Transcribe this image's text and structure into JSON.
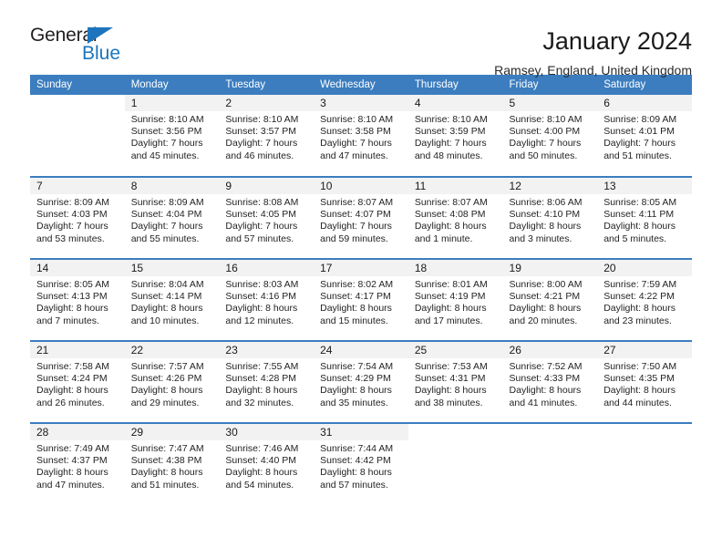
{
  "brand": {
    "name_part1": "General",
    "name_part2": "Blue",
    "accent_color": "#1c75bc",
    "triangle_icon": "brand-triangle-icon"
  },
  "header": {
    "title": "January 2024",
    "location": "Ramsey, England, United Kingdom"
  },
  "calendar": {
    "header_background": "#3b7dbf",
    "daynum_background": "#f2f2f2",
    "weekdays": [
      "Sunday",
      "Monday",
      "Tuesday",
      "Wednesday",
      "Thursday",
      "Friday",
      "Saturday"
    ],
    "weeks": [
      [
        {
          "day": "",
          "sunrise": "",
          "sunset": "",
          "daylight1": "",
          "daylight2": ""
        },
        {
          "day": "1",
          "sunrise": "Sunrise: 8:10 AM",
          "sunset": "Sunset: 3:56 PM",
          "daylight1": "Daylight: 7 hours",
          "daylight2": "and 45 minutes."
        },
        {
          "day": "2",
          "sunrise": "Sunrise: 8:10 AM",
          "sunset": "Sunset: 3:57 PM",
          "daylight1": "Daylight: 7 hours",
          "daylight2": "and 46 minutes."
        },
        {
          "day": "3",
          "sunrise": "Sunrise: 8:10 AM",
          "sunset": "Sunset: 3:58 PM",
          "daylight1": "Daylight: 7 hours",
          "daylight2": "and 47 minutes."
        },
        {
          "day": "4",
          "sunrise": "Sunrise: 8:10 AM",
          "sunset": "Sunset: 3:59 PM",
          "daylight1": "Daylight: 7 hours",
          "daylight2": "and 48 minutes."
        },
        {
          "day": "5",
          "sunrise": "Sunrise: 8:10 AM",
          "sunset": "Sunset: 4:00 PM",
          "daylight1": "Daylight: 7 hours",
          "daylight2": "and 50 minutes."
        },
        {
          "day": "6",
          "sunrise": "Sunrise: 8:09 AM",
          "sunset": "Sunset: 4:01 PM",
          "daylight1": "Daylight: 7 hours",
          "daylight2": "and 51 minutes."
        }
      ],
      [
        {
          "day": "7",
          "sunrise": "Sunrise: 8:09 AM",
          "sunset": "Sunset: 4:03 PM",
          "daylight1": "Daylight: 7 hours",
          "daylight2": "and 53 minutes."
        },
        {
          "day": "8",
          "sunrise": "Sunrise: 8:09 AM",
          "sunset": "Sunset: 4:04 PM",
          "daylight1": "Daylight: 7 hours",
          "daylight2": "and 55 minutes."
        },
        {
          "day": "9",
          "sunrise": "Sunrise: 8:08 AM",
          "sunset": "Sunset: 4:05 PM",
          "daylight1": "Daylight: 7 hours",
          "daylight2": "and 57 minutes."
        },
        {
          "day": "10",
          "sunrise": "Sunrise: 8:07 AM",
          "sunset": "Sunset: 4:07 PM",
          "daylight1": "Daylight: 7 hours",
          "daylight2": "and 59 minutes."
        },
        {
          "day": "11",
          "sunrise": "Sunrise: 8:07 AM",
          "sunset": "Sunset: 4:08 PM",
          "daylight1": "Daylight: 8 hours",
          "daylight2": "and 1 minute."
        },
        {
          "day": "12",
          "sunrise": "Sunrise: 8:06 AM",
          "sunset": "Sunset: 4:10 PM",
          "daylight1": "Daylight: 8 hours",
          "daylight2": "and 3 minutes."
        },
        {
          "day": "13",
          "sunrise": "Sunrise: 8:05 AM",
          "sunset": "Sunset: 4:11 PM",
          "daylight1": "Daylight: 8 hours",
          "daylight2": "and 5 minutes."
        }
      ],
      [
        {
          "day": "14",
          "sunrise": "Sunrise: 8:05 AM",
          "sunset": "Sunset: 4:13 PM",
          "daylight1": "Daylight: 8 hours",
          "daylight2": "and 7 minutes."
        },
        {
          "day": "15",
          "sunrise": "Sunrise: 8:04 AM",
          "sunset": "Sunset: 4:14 PM",
          "daylight1": "Daylight: 8 hours",
          "daylight2": "and 10 minutes."
        },
        {
          "day": "16",
          "sunrise": "Sunrise: 8:03 AM",
          "sunset": "Sunset: 4:16 PM",
          "daylight1": "Daylight: 8 hours",
          "daylight2": "and 12 minutes."
        },
        {
          "day": "17",
          "sunrise": "Sunrise: 8:02 AM",
          "sunset": "Sunset: 4:17 PM",
          "daylight1": "Daylight: 8 hours",
          "daylight2": "and 15 minutes."
        },
        {
          "day": "18",
          "sunrise": "Sunrise: 8:01 AM",
          "sunset": "Sunset: 4:19 PM",
          "daylight1": "Daylight: 8 hours",
          "daylight2": "and 17 minutes."
        },
        {
          "day": "19",
          "sunrise": "Sunrise: 8:00 AM",
          "sunset": "Sunset: 4:21 PM",
          "daylight1": "Daylight: 8 hours",
          "daylight2": "and 20 minutes."
        },
        {
          "day": "20",
          "sunrise": "Sunrise: 7:59 AM",
          "sunset": "Sunset: 4:22 PM",
          "daylight1": "Daylight: 8 hours",
          "daylight2": "and 23 minutes."
        }
      ],
      [
        {
          "day": "21",
          "sunrise": "Sunrise: 7:58 AM",
          "sunset": "Sunset: 4:24 PM",
          "daylight1": "Daylight: 8 hours",
          "daylight2": "and 26 minutes."
        },
        {
          "day": "22",
          "sunrise": "Sunrise: 7:57 AM",
          "sunset": "Sunset: 4:26 PM",
          "daylight1": "Daylight: 8 hours",
          "daylight2": "and 29 minutes."
        },
        {
          "day": "23",
          "sunrise": "Sunrise: 7:55 AM",
          "sunset": "Sunset: 4:28 PM",
          "daylight1": "Daylight: 8 hours",
          "daylight2": "and 32 minutes."
        },
        {
          "day": "24",
          "sunrise": "Sunrise: 7:54 AM",
          "sunset": "Sunset: 4:29 PM",
          "daylight1": "Daylight: 8 hours",
          "daylight2": "and 35 minutes."
        },
        {
          "day": "25",
          "sunrise": "Sunrise: 7:53 AM",
          "sunset": "Sunset: 4:31 PM",
          "daylight1": "Daylight: 8 hours",
          "daylight2": "and 38 minutes."
        },
        {
          "day": "26",
          "sunrise": "Sunrise: 7:52 AM",
          "sunset": "Sunset: 4:33 PM",
          "daylight1": "Daylight: 8 hours",
          "daylight2": "and 41 minutes."
        },
        {
          "day": "27",
          "sunrise": "Sunrise: 7:50 AM",
          "sunset": "Sunset: 4:35 PM",
          "daylight1": "Daylight: 8 hours",
          "daylight2": "and 44 minutes."
        }
      ],
      [
        {
          "day": "28",
          "sunrise": "Sunrise: 7:49 AM",
          "sunset": "Sunset: 4:37 PM",
          "daylight1": "Daylight: 8 hours",
          "daylight2": "and 47 minutes."
        },
        {
          "day": "29",
          "sunrise": "Sunrise: 7:47 AM",
          "sunset": "Sunset: 4:38 PM",
          "daylight1": "Daylight: 8 hours",
          "daylight2": "and 51 minutes."
        },
        {
          "day": "30",
          "sunrise": "Sunrise: 7:46 AM",
          "sunset": "Sunset: 4:40 PM",
          "daylight1": "Daylight: 8 hours",
          "daylight2": "and 54 minutes."
        },
        {
          "day": "31",
          "sunrise": "Sunrise: 7:44 AM",
          "sunset": "Sunset: 4:42 PM",
          "daylight1": "Daylight: 8 hours",
          "daylight2": "and 57 minutes."
        },
        {
          "day": "",
          "sunrise": "",
          "sunset": "",
          "daylight1": "",
          "daylight2": ""
        },
        {
          "day": "",
          "sunrise": "",
          "sunset": "",
          "daylight1": "",
          "daylight2": ""
        },
        {
          "day": "",
          "sunrise": "",
          "sunset": "",
          "daylight1": "",
          "daylight2": ""
        }
      ]
    ]
  }
}
